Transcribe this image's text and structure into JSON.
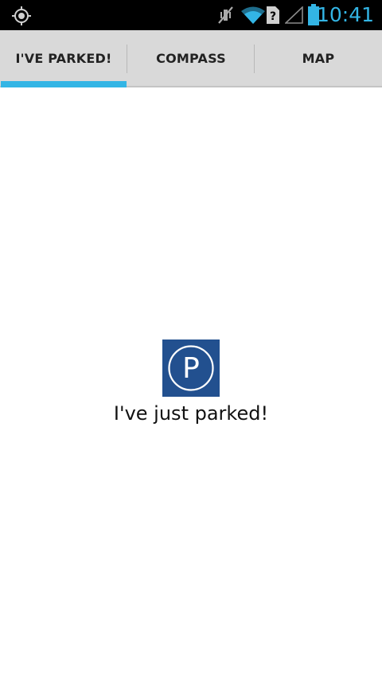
{
  "status_bar": {
    "time": "10:41",
    "icons": [
      "gps-icon",
      "vibrate-muted-icon",
      "wifi-icon",
      "sim-unknown-icon",
      "cell-signal-icon",
      "battery-icon"
    ],
    "accent_color": "#33b5e5"
  },
  "tabs": [
    {
      "label": "I'VE PARKED!",
      "selected": true
    },
    {
      "label": "COMPASS",
      "selected": false
    },
    {
      "label": "MAP",
      "selected": false
    }
  ],
  "main": {
    "parked_label": "I've just parked!",
    "logo_icon": "parking-sign-icon",
    "logo_letter": "P",
    "logo_color": "#22508f"
  },
  "colors": {
    "tab_bar": "#d9d9d9",
    "tab_indicator": "#33b5e5",
    "background": "#ffffff"
  }
}
